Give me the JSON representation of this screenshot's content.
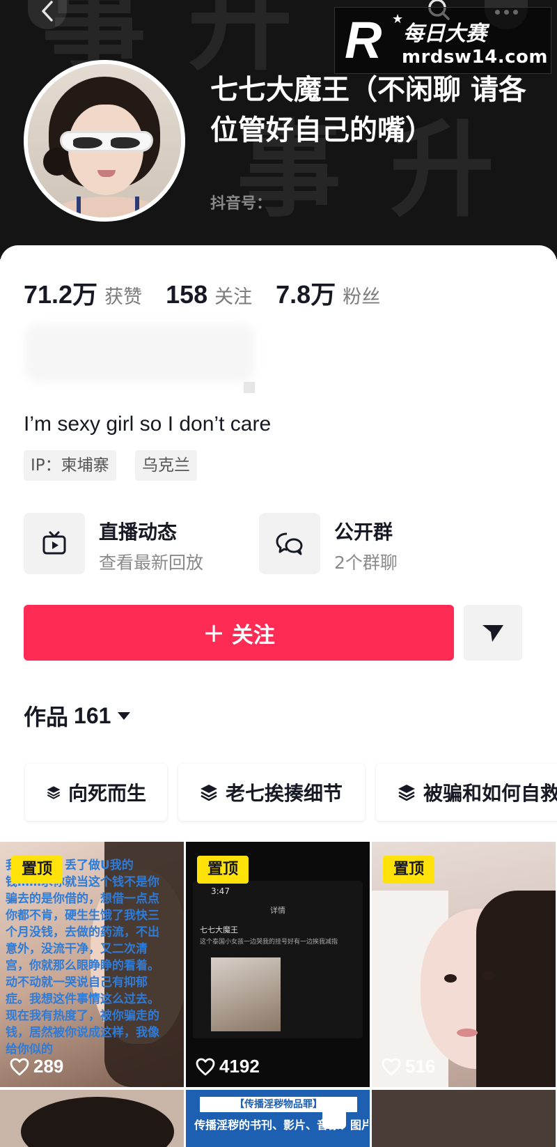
{
  "watermark": {
    "brand_logo": "R",
    "brand_cn": "每日大赛",
    "url": "mrdsw14.com"
  },
  "profile": {
    "name": "七七大魔王（不闲聊 请各位管好自己的嘴）",
    "douyin_id_label": "抖音号："
  },
  "stats": [
    {
      "value": "71.2万",
      "label": "获赞"
    },
    {
      "value": "158",
      "label": "关注"
    },
    {
      "value": "7.8万",
      "label": "粉丝"
    }
  ],
  "bio": "I’m sexy girl so I don’t care",
  "tags": [
    "IP：柬埔寨",
    "乌克兰"
  ],
  "features": [
    {
      "title": "直播动态",
      "subtitle": "查看最新回放",
      "icon": "tv-icon"
    },
    {
      "title": "公开群",
      "subtitle": "2个群聊",
      "icon": "chat-bubbles-icon"
    }
  ],
  "follow_button": {
    "plus": "+",
    "label": "关注"
  },
  "works": {
    "label": "作品",
    "count": "161"
  },
  "collections": [
    "向死而生",
    "老七挨揍细节",
    "被骗和如何自救"
  ],
  "videos": [
    {
      "pinned": "置顶",
      "likes": "289",
      "overlay_text": "我本出来，丢了做U我的钱……求你就当这个钱不是你骗去的是你借的，想借一点点你都不肯，硬生生饿了我快三个月没钱，去做的药流，不出意外，没流干净，又二次清宫，你就那么眼睁睁的看着。动不动就一哭说自己有抑郁症。我想这件事情这么过去。现在我有热度了，被你骗走的钱，居然被你说成这样，我像给你似的"
    },
    {
      "pinned": "置顶",
      "likes": "4192",
      "screen_time": "3:47",
      "screen_header": "详情",
      "screen_user": "七七大魔王",
      "screen_text": "这个泰国小女孩一边哭我的挂号好有一边挨我减指"
    },
    {
      "pinned": "置顶",
      "likes": "516"
    },
    {
      "likes": ""
    },
    {
      "likes": "",
      "banner": "【传播淫秽物品罪】",
      "text": "传播淫秽的书刊、影片、音像、图片或者其他淫秽物品，情节严重的，处二年以下有期徒刑、拘"
    },
    {
      "likes": ""
    }
  ],
  "colors": {
    "accent": "#fe2c55",
    "pinned_badge": "#fee20a",
    "header_bg": "#141414"
  }
}
